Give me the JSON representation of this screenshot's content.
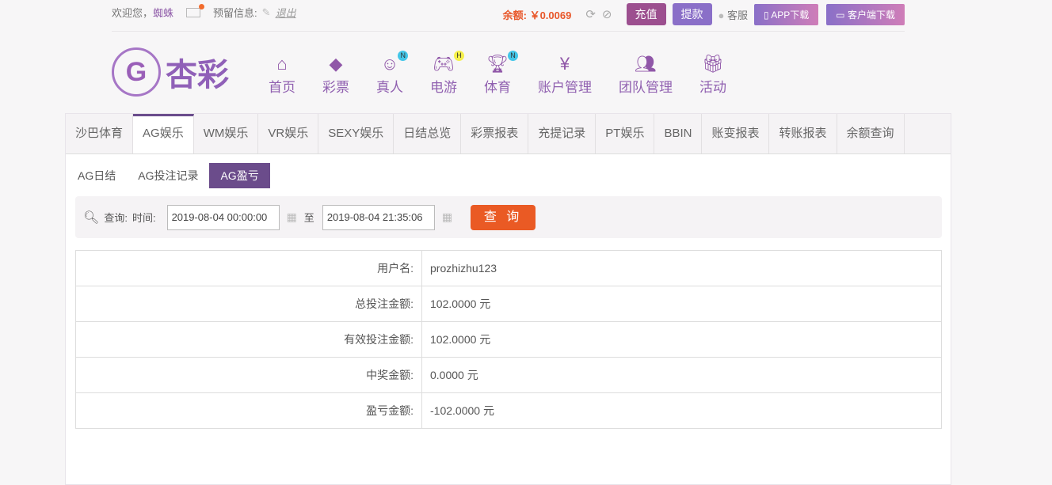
{
  "topbar": {
    "welcome": "欢迎您，",
    "username": "蜘蛛",
    "reserved_info": "预留信息:",
    "logout": "退出",
    "balance_label": "余额:",
    "balance": "￥0.0069",
    "recharge": "充值",
    "withdraw": "提款",
    "support": "客服",
    "app_download": "APP下载",
    "client_download": "客户端下载"
  },
  "logo": {
    "text": "杏彩"
  },
  "nav": [
    {
      "label": "首页",
      "icon": "home-icon"
    },
    {
      "label": "彩票",
      "icon": "ticket-icon"
    },
    {
      "label": "真人",
      "icon": "woman-icon",
      "badge": "N"
    },
    {
      "label": "电游",
      "icon": "gamepad-icon",
      "badge": "H"
    },
    {
      "label": "体育",
      "icon": "trophy-icon",
      "badge": "N"
    },
    {
      "label": "账户管理",
      "icon": "yen-coin-icon"
    },
    {
      "label": "团队管理",
      "icon": "team-icon"
    },
    {
      "label": "活动",
      "icon": "gift-icon"
    }
  ],
  "tabs": [
    "沙巴体育",
    "AG娱乐",
    "WM娱乐",
    "VR娱乐",
    "SEXY娱乐",
    "日结总览",
    "彩票报表",
    "充提记录",
    "PT娱乐",
    "BBIN",
    "账变报表",
    "转账报表",
    "余额查询"
  ],
  "active_tab": "AG娱乐",
  "subtabs": [
    "AG日结",
    "AG投注记录",
    "AG盈亏"
  ],
  "active_subtab": "AG盈亏",
  "query": {
    "label": "查询:",
    "time_label": "时间:",
    "start": "2019-08-04 00:00:00",
    "to": "至",
    "end": "2019-08-04 21:35:06",
    "button": "查 询"
  },
  "rows": [
    {
      "k": "用户名:",
      "v": "prozhizhu123"
    },
    {
      "k": "总投注金额:",
      "v": "102.0000 元"
    },
    {
      "k": "有效投注金额:",
      "v": "102.0000 元"
    },
    {
      "k": "中奖金额:",
      "v": "0.0000 元"
    },
    {
      "k": "盈亏金额:",
      "v": "-102.0000 元"
    }
  ],
  "colors": {
    "accent": "#6b4c8b",
    "balance": "#e8572a",
    "query_button": "#ea5a24"
  }
}
